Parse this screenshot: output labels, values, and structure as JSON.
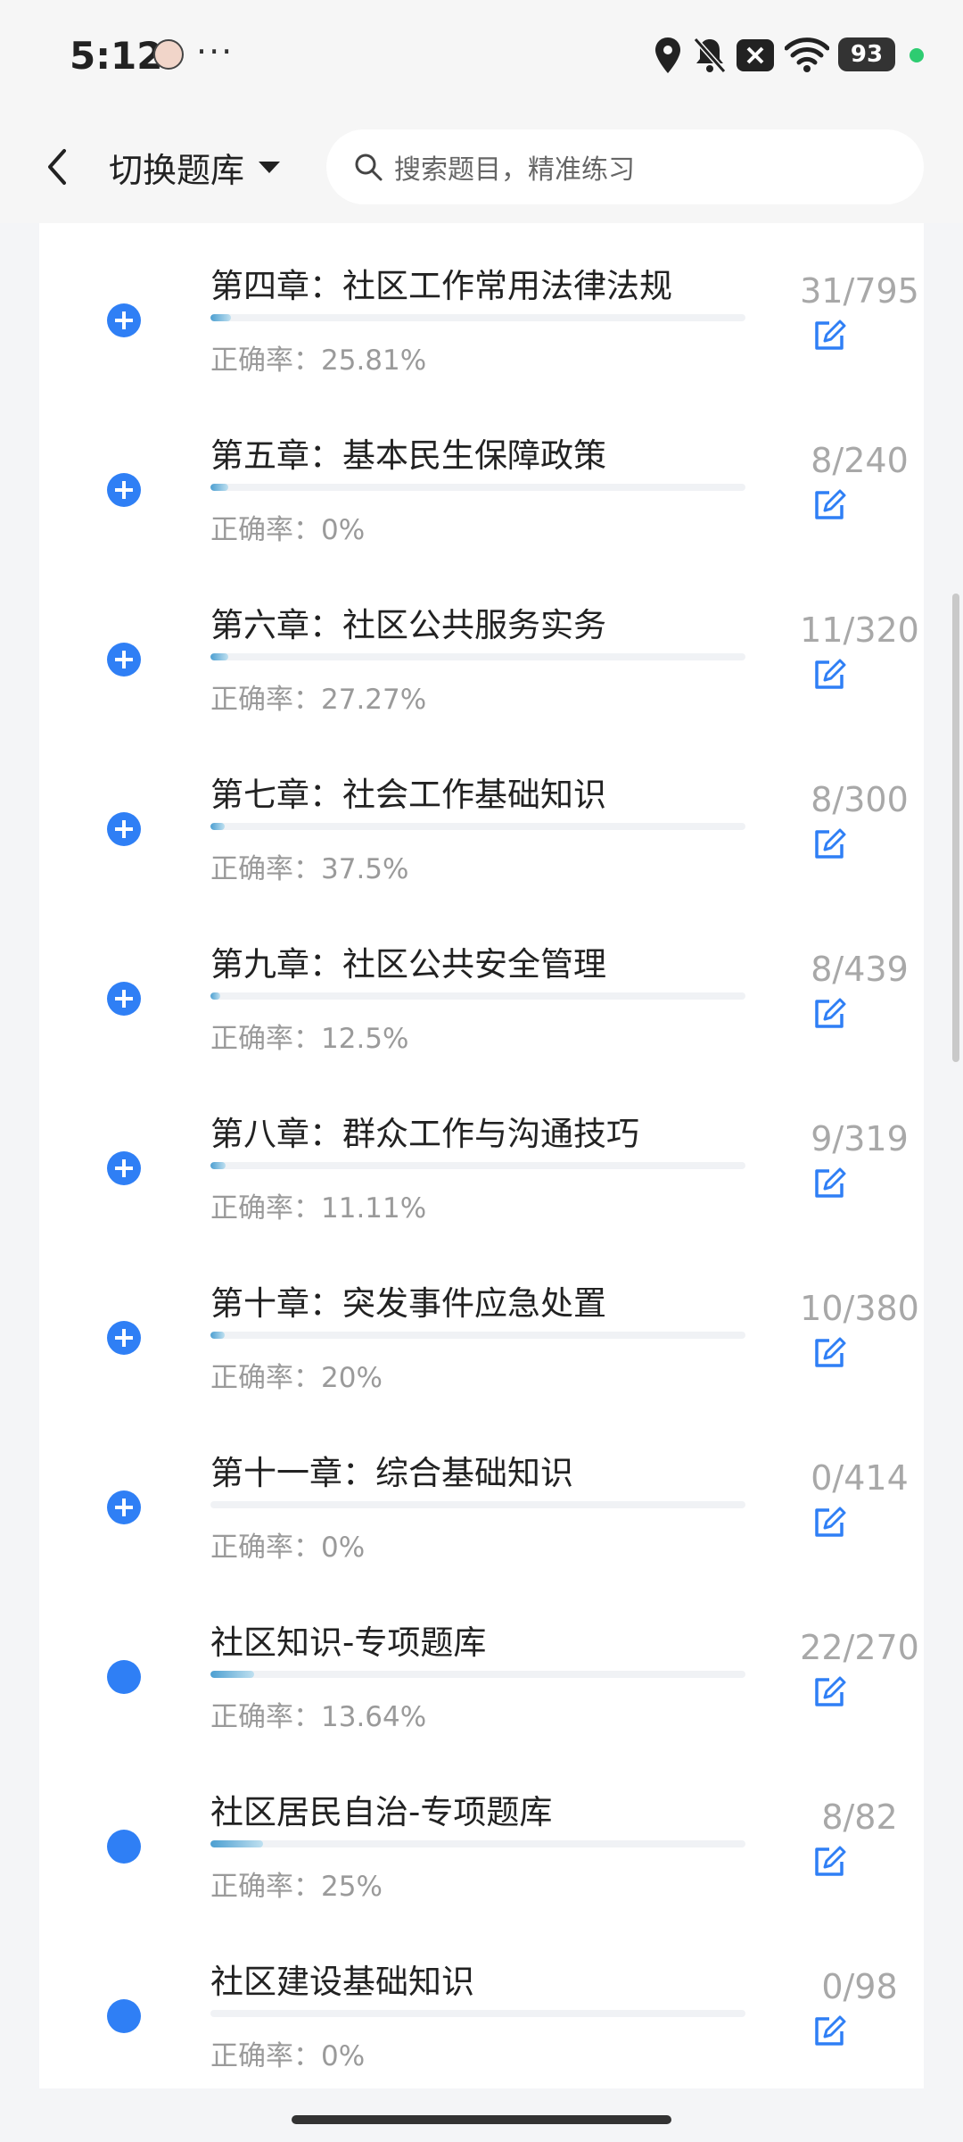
{
  "status": {
    "time": "5:12",
    "battery": "93"
  },
  "header": {
    "switch_label": "切换题库",
    "search_placeholder": "搜索题目，精准练习"
  },
  "items": [
    {
      "title": "第四章：社区工作常用法律法规",
      "accuracy": "正确率：25.81%",
      "count": "31/795",
      "progress": 0.039,
      "icon": "plus"
    },
    {
      "title": "第五章：基本民生保障政策",
      "accuracy": "正确率：0%",
      "count": "8/240",
      "progress": 0.033,
      "icon": "plus"
    },
    {
      "title": "第六章：社区公共服务实务",
      "accuracy": "正确率：27.27%",
      "count": "11/320",
      "progress": 0.034,
      "icon": "plus"
    },
    {
      "title": "第七章：社会工作基础知识",
      "accuracy": "正确率：37.5%",
      "count": "8/300",
      "progress": 0.027,
      "icon": "plus"
    },
    {
      "title": "第九章：社区公共安全管理",
      "accuracy": "正确率：12.5%",
      "count": "8/439",
      "progress": 0.018,
      "icon": "plus"
    },
    {
      "title": "第八章：群众工作与沟通技巧",
      "accuracy": "正确率：11.11%",
      "count": "9/319",
      "progress": 0.028,
      "icon": "plus"
    },
    {
      "title": "第十章：突发事件应急处置",
      "accuracy": "正确率：20%",
      "count": "10/380",
      "progress": 0.026,
      "icon": "plus"
    },
    {
      "title": "第十一章：综合基础知识",
      "accuracy": "正确率：0%",
      "count": "0/414",
      "progress": 0.0,
      "icon": "plus"
    },
    {
      "title": "社区知识-专项题库",
      "accuracy": "正确率：13.64%",
      "count": "22/270",
      "progress": 0.081,
      "icon": "dot"
    },
    {
      "title": "社区居民自治-专项题库",
      "accuracy": "正确率：25%",
      "count": "8/82",
      "progress": 0.098,
      "icon": "dot"
    },
    {
      "title": "社区建设基础知识",
      "accuracy": "正确率：0%",
      "count": "0/98",
      "progress": 0.0,
      "icon": "dot"
    }
  ],
  "colors": {
    "accent": "#2f7ff5",
    "progress": "#4c9fd1"
  }
}
